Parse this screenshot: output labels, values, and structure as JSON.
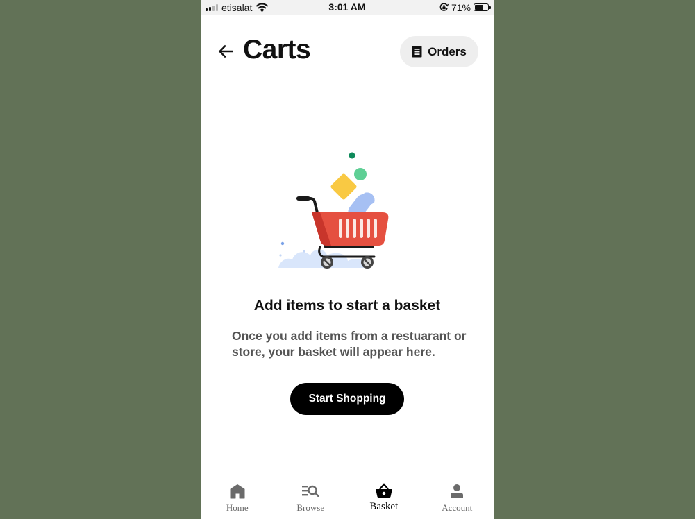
{
  "colors": {
    "backdrop": "#627257",
    "surface": "#ffffff",
    "primary": "#000000",
    "muted_text": "#545454",
    "nav_inactive": "#6b6b6b",
    "chip_background": "#eeeeee"
  },
  "status_bar": {
    "carrier": "etisalat",
    "time": "3:01 AM",
    "battery_percent_label": "71%",
    "battery_level": 0.71,
    "signal_bars": 2,
    "icons": [
      "signal-icon",
      "wifi-icon",
      "orientation-lock-icon",
      "battery-icon"
    ]
  },
  "header": {
    "back_icon": "arrow-left-icon",
    "title": "Carts",
    "orders_button": {
      "icon": "receipt-icon",
      "label": "Orders"
    }
  },
  "empty_state": {
    "illustration": "shopping-cart-illustration",
    "title": "Add items to start a basket",
    "description": "Once you add items from a restuarant or store, your basket will appear here.",
    "cta_label": "Start Shopping"
  },
  "bottom_nav": {
    "items": [
      {
        "label": "Home",
        "icon": "home-icon",
        "active": false
      },
      {
        "label": "Browse",
        "icon": "browse-search-icon",
        "active": false
      },
      {
        "label": "Basket",
        "icon": "basket-icon",
        "active": true
      },
      {
        "label": "Account",
        "icon": "account-icon",
        "active": false
      }
    ]
  }
}
